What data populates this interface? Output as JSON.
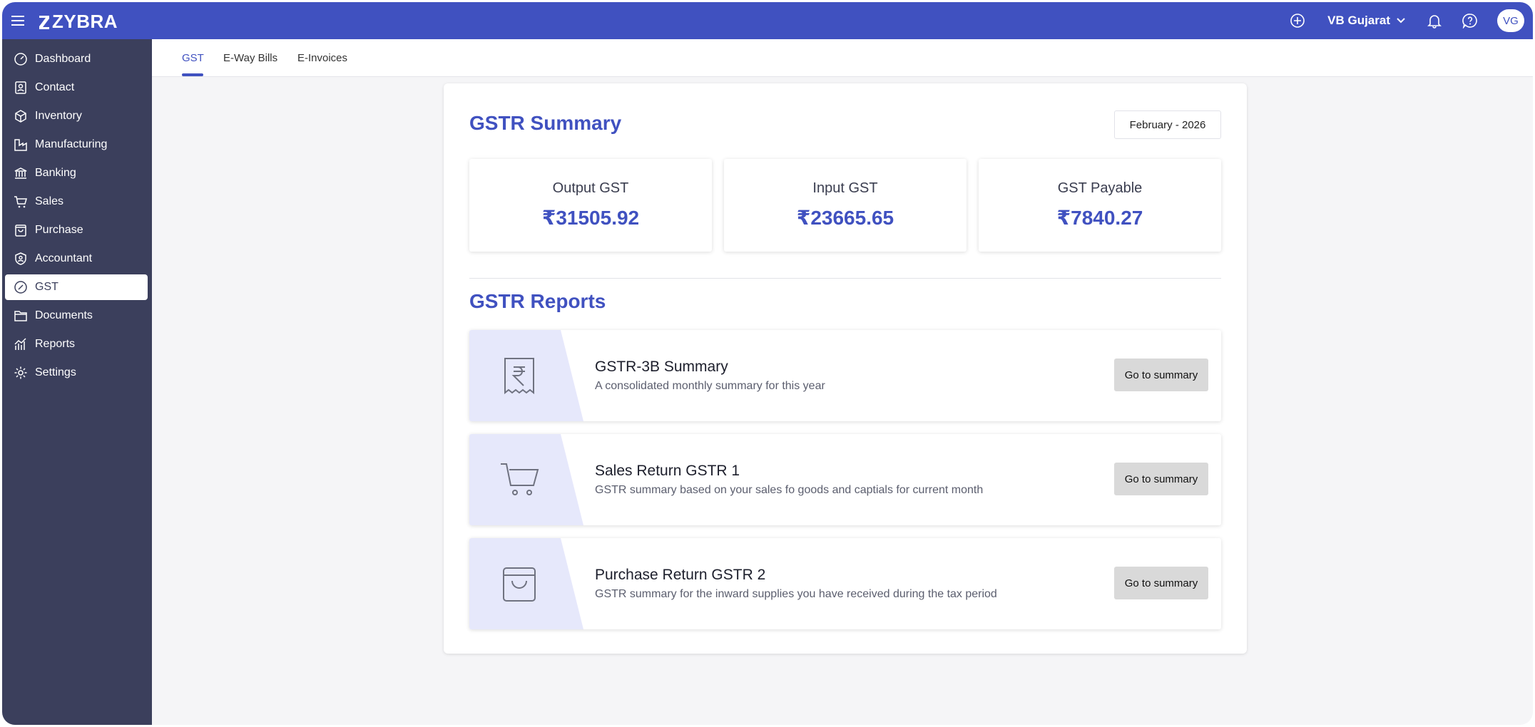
{
  "app": {
    "brand": "ZYBRA"
  },
  "topbar": {
    "org_name": "VB Gujarat",
    "avatar_initials": "VG"
  },
  "sidebar": {
    "items": [
      {
        "label": "Dashboard",
        "icon": "gauge-icon"
      },
      {
        "label": "Contact",
        "icon": "contact-card-icon"
      },
      {
        "label": "Inventory",
        "icon": "box-icon"
      },
      {
        "label": "Manufacturing",
        "icon": "factory-icon"
      },
      {
        "label": "Banking",
        "icon": "bank-icon"
      },
      {
        "label": "Sales",
        "icon": "cart-icon"
      },
      {
        "label": "Purchase",
        "icon": "bag-icon"
      },
      {
        "label": "Accountant",
        "icon": "shield-user-icon"
      },
      {
        "label": "GST",
        "icon": "percent-circle-icon",
        "active": true
      },
      {
        "label": "Documents",
        "icon": "folder-icon"
      },
      {
        "label": "Reports",
        "icon": "chart-icon"
      },
      {
        "label": "Settings",
        "icon": "gear-icon"
      }
    ]
  },
  "tabs": [
    {
      "label": "GST",
      "active": true
    },
    {
      "label": "E-Way Bills"
    },
    {
      "label": "E-Invoices"
    }
  ],
  "summary": {
    "title": "GSTR Summary",
    "period": "February - 2026",
    "stats": [
      {
        "label": "Output GST",
        "value": "₹31505.92"
      },
      {
        "label": "Input GST",
        "value": "₹23665.65"
      },
      {
        "label": "GST Payable",
        "value": "₹7840.27"
      }
    ]
  },
  "reports": {
    "title": "GSTR Reports",
    "items": [
      {
        "title": "GSTR-3B Summary",
        "desc": "A consolidated monthly summary for this year",
        "button": "Go to summary",
        "icon": "receipt-rupee-icon"
      },
      {
        "title": "Sales Return GSTR 1",
        "desc": "GSTR summary based on your sales fo goods and captials for current month",
        "button": "Go to summary",
        "icon": "cart-icon"
      },
      {
        "title": "Purchase Return GSTR 2",
        "desc": "GSTR summary for the inward supplies you have received during the tax period",
        "button": "Go to summary",
        "icon": "shopping-bag-icon"
      }
    ]
  },
  "colors": {
    "primary": "#4051c0",
    "sidebar": "#3b3f5c",
    "band": "#e6e8fb"
  }
}
